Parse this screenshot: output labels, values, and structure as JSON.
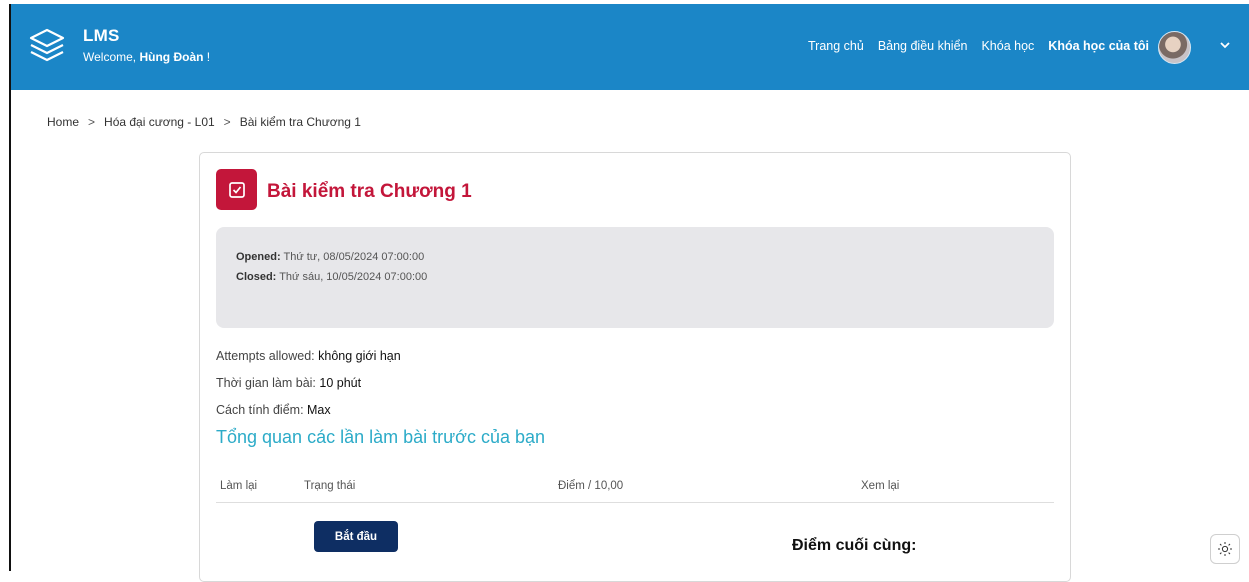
{
  "navbar": {
    "brand_name": "LMS",
    "welcome_prefix": "Welcome, ",
    "user_name": "Hùng Đoàn",
    "welcome_suffix": " !",
    "links": [
      "Trang chủ",
      "Bảng điều khiển",
      "Khóa học",
      "Khóa học của tôi"
    ],
    "active_link": "Khóa học của tôi"
  },
  "breadcrumb": {
    "items": [
      "Home",
      "Hóa đại cương - L01",
      "Bài kiểm tra Chương 1"
    ],
    "separator": ">"
  },
  "quiz": {
    "title": "Bài kiểm tra Chương 1",
    "opened_label": "Opened:",
    "opened_value": "Thứ tư, 08/05/2024 07:00:00",
    "closed_label": "Closed:",
    "closed_value": "Thứ sáu, 10/05/2024 07:00:00",
    "attempts_label": "Attempts allowed: ",
    "attempts_value": "không giới hạn",
    "time_label": "Thời gian làm bài: ",
    "time_value": "10 phút",
    "grading_label": "Cách tính điểm: ",
    "grading_value": "Max",
    "summary_heading": "Tổng quan các lần làm bài trước của bạn",
    "table_headers": [
      "Làm lại",
      "Trạng thái",
      "Điểm / 10,00",
      "Xem lại"
    ],
    "start_button": "Bắt đầu",
    "final_grade_label": "Điểm cuối cùng:"
  },
  "colors": {
    "navbar": "#1b86c7",
    "accent_red": "#c3163a",
    "summary_teal": "#2cabc8",
    "button_navy": "#0e2e63"
  },
  "icons": {
    "logo": "layers-icon",
    "quiz": "checkbox-icon",
    "dropdown": "chevron-down-icon",
    "theme": "sun-icon"
  }
}
